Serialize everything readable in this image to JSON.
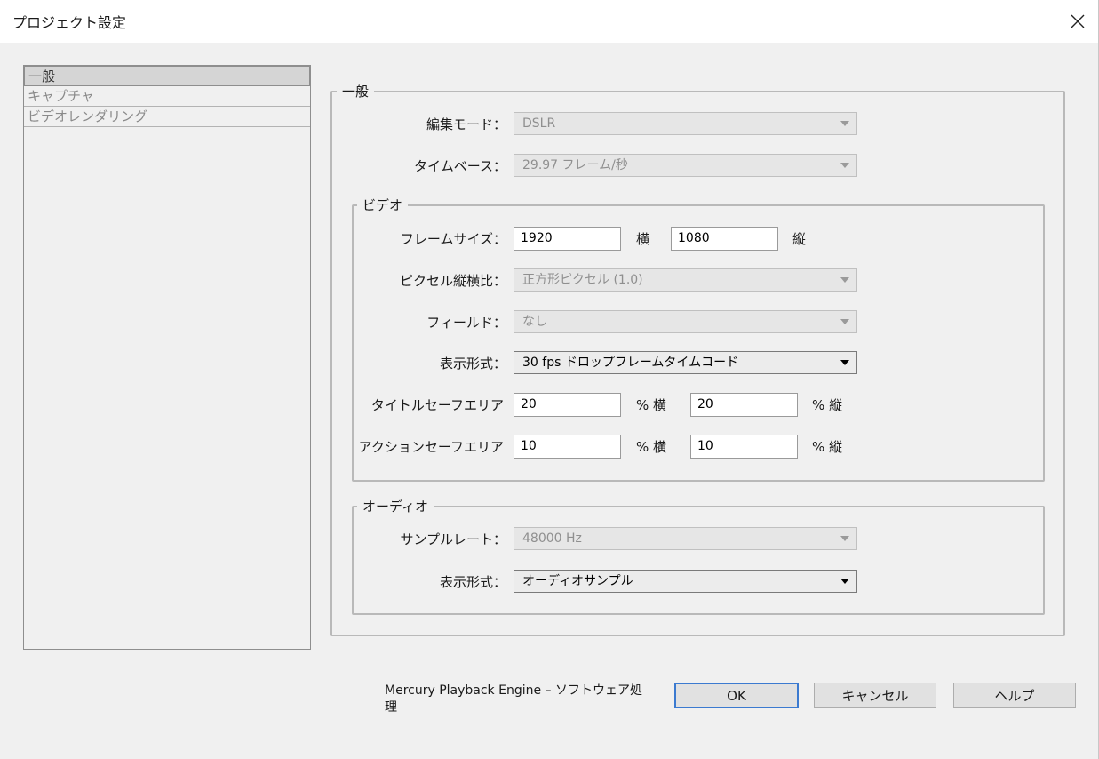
{
  "window": {
    "title": "プロジェクト設定",
    "close_icon": "close-icon"
  },
  "sidebar": {
    "items": [
      {
        "label": "一般",
        "selected": true
      },
      {
        "label": "キャプチャ",
        "selected": false
      },
      {
        "label": "ビデオレンダリング",
        "selected": false
      }
    ]
  },
  "general": {
    "legend": "一般",
    "edit_mode": {
      "label": "編集モード：",
      "value": "DSLR",
      "enabled": false
    },
    "timebase": {
      "label": "タイムベース：",
      "value": "29.97 フレーム/秒",
      "enabled": false
    }
  },
  "video": {
    "legend": "ビデオ",
    "frame_size": {
      "label": "フレームサイズ：",
      "width": "1920",
      "width_unit": "横",
      "height": "1080",
      "height_unit": "縦"
    },
    "pixel_aspect": {
      "label": "ピクセル縦横比：",
      "value": "正方形ピクセル (1.0)",
      "enabled": false
    },
    "fields": {
      "label": "フィールド：",
      "value": "なし",
      "enabled": false
    },
    "display_format": {
      "label": "表示形式：",
      "value": "30 fps ドロップフレームタイムコード",
      "enabled": true
    },
    "title_safe": {
      "label": "タイトルセーフエリア",
      "h": "20",
      "h_unit": "% 横",
      "v": "20",
      "v_unit": "% 縦"
    },
    "action_safe": {
      "label": "アクションセーフエリア",
      "h": "10",
      "h_unit": "% 横",
      "v": "10",
      "v_unit": "% 縦"
    }
  },
  "audio": {
    "legend": "オーディオ",
    "sample_rate": {
      "label": "サンプルレート：",
      "value": "48000 Hz",
      "enabled": false
    },
    "display_format": {
      "label": "表示形式：",
      "value": "オーディオサンプル",
      "enabled": true
    }
  },
  "footer": {
    "engine_text": "Mercury Playback Engine – ソフトウェア処理",
    "ok": "OK",
    "cancel": "キャンセル",
    "help": "ヘルプ"
  }
}
